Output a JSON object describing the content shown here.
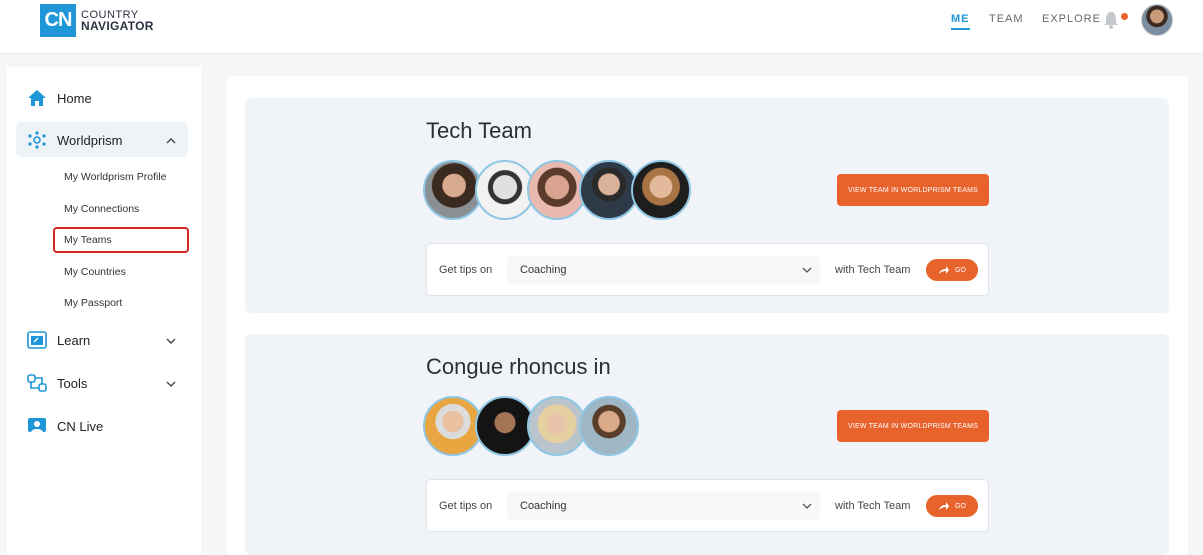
{
  "header": {
    "logo_mark": "CN",
    "logo_line1": "COUNTRY",
    "logo_line2": "NAVIGATOR",
    "nav": [
      "ME",
      "TEAM",
      "EXPLORE"
    ],
    "active_nav": "ME",
    "accent_color": "#1e96d8",
    "notification_color": "#e8622c"
  },
  "sidebar": {
    "items": [
      {
        "label": "Home",
        "icon": "home-icon"
      },
      {
        "label": "Worldprism",
        "icon": "worldprism-icon",
        "expanded": true
      },
      {
        "label": "Learn",
        "icon": "learn-icon"
      },
      {
        "label": "Tools",
        "icon": "tools-icon"
      },
      {
        "label": "CN Live",
        "icon": "cn-live-icon"
      }
    ],
    "subitems": [
      "My Worldprism Profile",
      "My Connections",
      "My Teams",
      "My Countries",
      "My Passport"
    ],
    "selected_subitem": "My Teams"
  },
  "teams": [
    {
      "title": "Tech Team",
      "view_button": "VIEW TEAM IN WORLDPRISM TEAMS",
      "tips_label": "Get tips on",
      "topic": "Coaching",
      "with_label": "with Tech Team",
      "go_label": "GO"
    },
    {
      "title": "Congue rhoncus in",
      "view_button": "VIEW TEAM IN WORLDPRISM TEAMS",
      "tips_label": "Get tips on",
      "topic": "Coaching",
      "with_label": "with Tech Team",
      "go_label": "GO"
    }
  ],
  "colors": {
    "button_orange": "#e8622c",
    "highlight_red": "#d62626"
  }
}
